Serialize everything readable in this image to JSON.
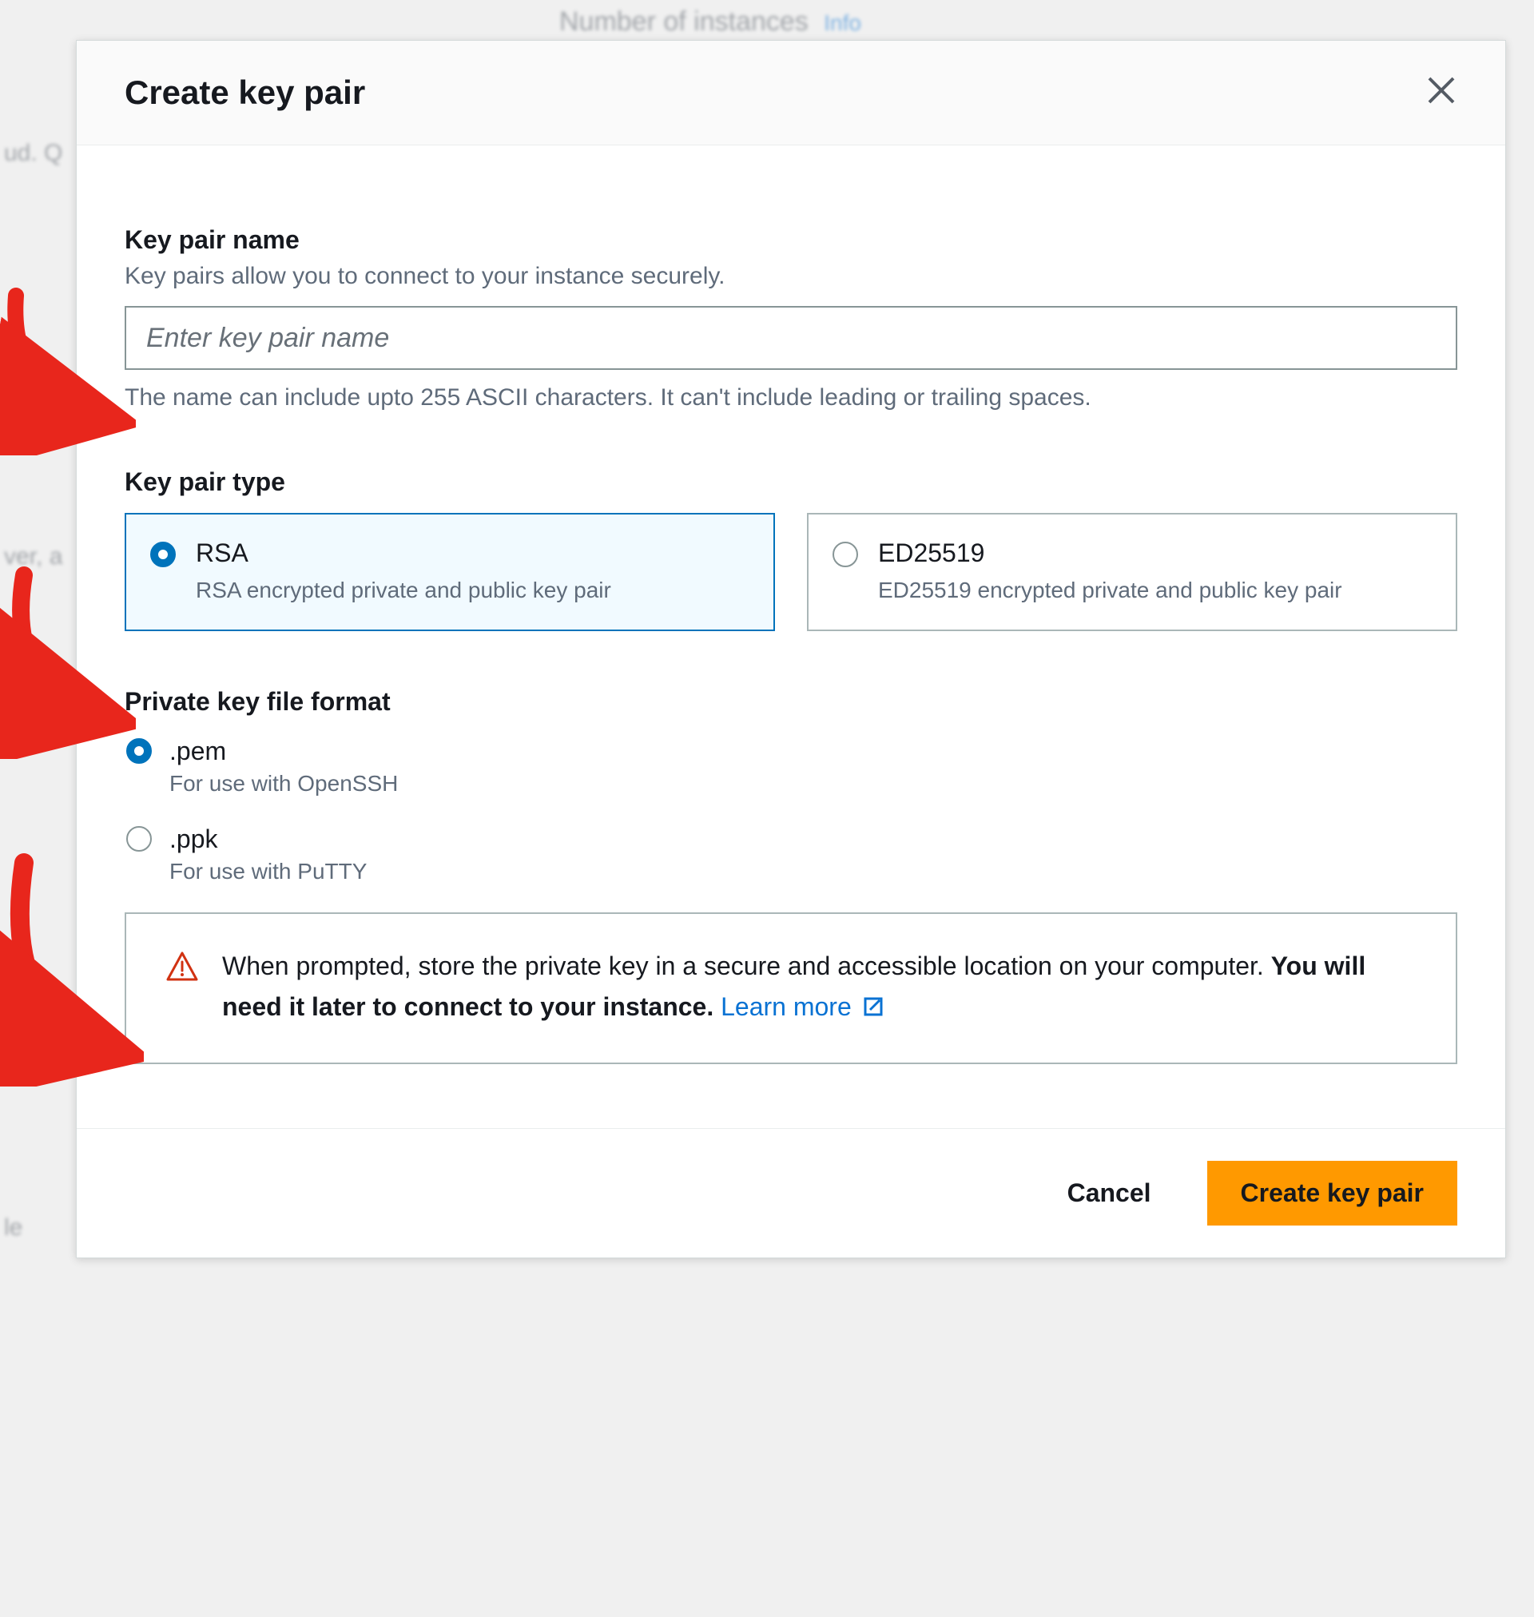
{
  "background": {
    "header_text": "Number of instances",
    "info_label": "Info",
    "frag1": "ud. Q",
    "frag2": "ver, a",
    "frag3": "le"
  },
  "modal": {
    "title": "Create key pair",
    "keypair_name": {
      "label": "Key pair name",
      "sublabel": "Key pairs allow you to connect to your instance securely.",
      "placeholder": "Enter key pair name",
      "hint": "The name can include upto 255 ASCII characters. It can't include leading or trailing spaces."
    },
    "keypair_type": {
      "label": "Key pair type",
      "options": [
        {
          "title": "RSA",
          "desc": "RSA encrypted private and public key pair",
          "selected": true
        },
        {
          "title": "ED25519",
          "desc": "ED25519 encrypted private and public key pair",
          "selected": false
        }
      ]
    },
    "file_format": {
      "label": "Private key file format",
      "options": [
        {
          "title": ".pem",
          "desc": "For use with OpenSSH",
          "selected": true
        },
        {
          "title": ".ppk",
          "desc": "For use with PuTTY",
          "selected": false
        }
      ]
    },
    "alert": {
      "text1": "When prompted, store the private key in a secure and accessible location on your computer. ",
      "text2": "You will need it later to connect to your instance.",
      "learn_more": "Learn more"
    },
    "footer": {
      "cancel": "Cancel",
      "submit": "Create key pair"
    }
  }
}
